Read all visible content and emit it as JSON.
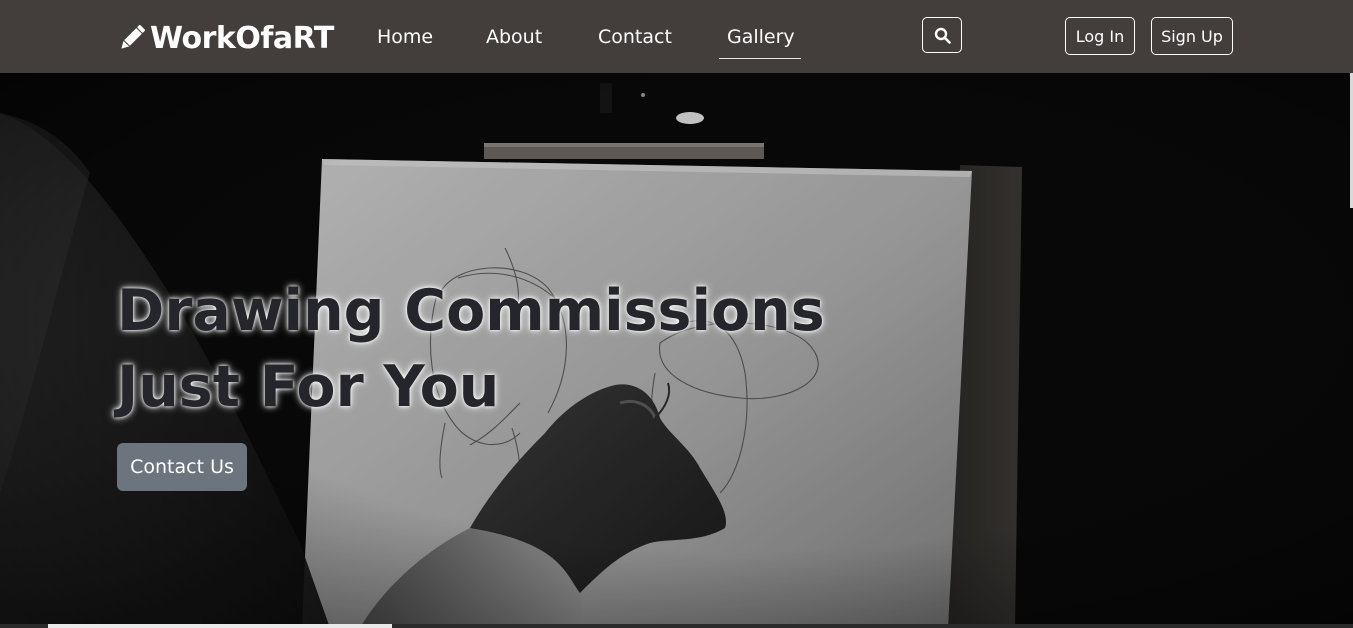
{
  "brand": {
    "name": "WorkOfaRT",
    "icon": "pencil-icon"
  },
  "nav": {
    "items": [
      {
        "label": "Home"
      },
      {
        "label": "About"
      },
      {
        "label": "Contact"
      },
      {
        "label": "Gallery",
        "active": true
      }
    ],
    "search_icon": "search-icon",
    "login_label": "Log In",
    "signup_label": "Sign Up"
  },
  "hero": {
    "title_line1": "Drawing Commissions",
    "title_line2": "Just For You",
    "cta_label": "Contact Us"
  },
  "colors": {
    "navbar_bg": "#433d3b",
    "cta_bg": "#6c757d",
    "hero_title": "#24262b"
  }
}
